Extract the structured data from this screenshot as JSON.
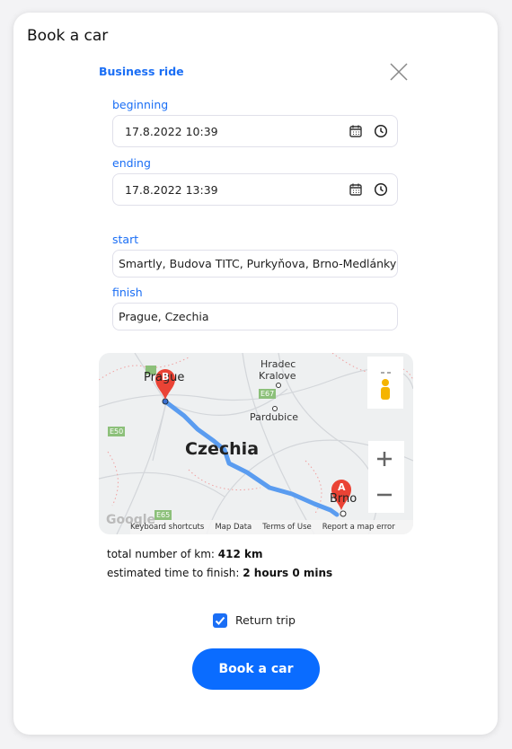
{
  "title": "Book a car",
  "subtitle": "Business ride",
  "fields": {
    "beginning": {
      "label": "beginning",
      "value": "17.8.2022 10:39"
    },
    "ending": {
      "label": "ending",
      "value": "17.8.2022 13:39"
    },
    "start": {
      "label": "start",
      "value": "Smartly, Budova TITC, Purkyňova, Brno-Medlánky"
    },
    "finish": {
      "label": "finish",
      "value": "Prague, Czechia"
    }
  },
  "map": {
    "labels": {
      "prague": "Prague",
      "brno": "Brno",
      "hradec": "Hradec",
      "kralove": "Kralove",
      "pardubice": "Pardubice",
      "country": "Czechia",
      "e67": "E67",
      "e50": "E50",
      "e65": "E65",
      "marker_a": "A",
      "marker_b": "B",
      "google": "Google"
    },
    "footer": [
      "Keyboard shortcuts",
      "Map Data",
      "Terms of Use",
      "Report a map error"
    ],
    "route_color": "#5a9cf0"
  },
  "summary": {
    "km_label": "total number of km:",
    "km_value": "412 km",
    "time_label": "estimated time to finish:",
    "time_value": "2 hours 0 mins"
  },
  "return_trip": {
    "label": "Return trip",
    "checked": true
  },
  "submit_label": "Book a car",
  "accent": "#1a6ef5"
}
